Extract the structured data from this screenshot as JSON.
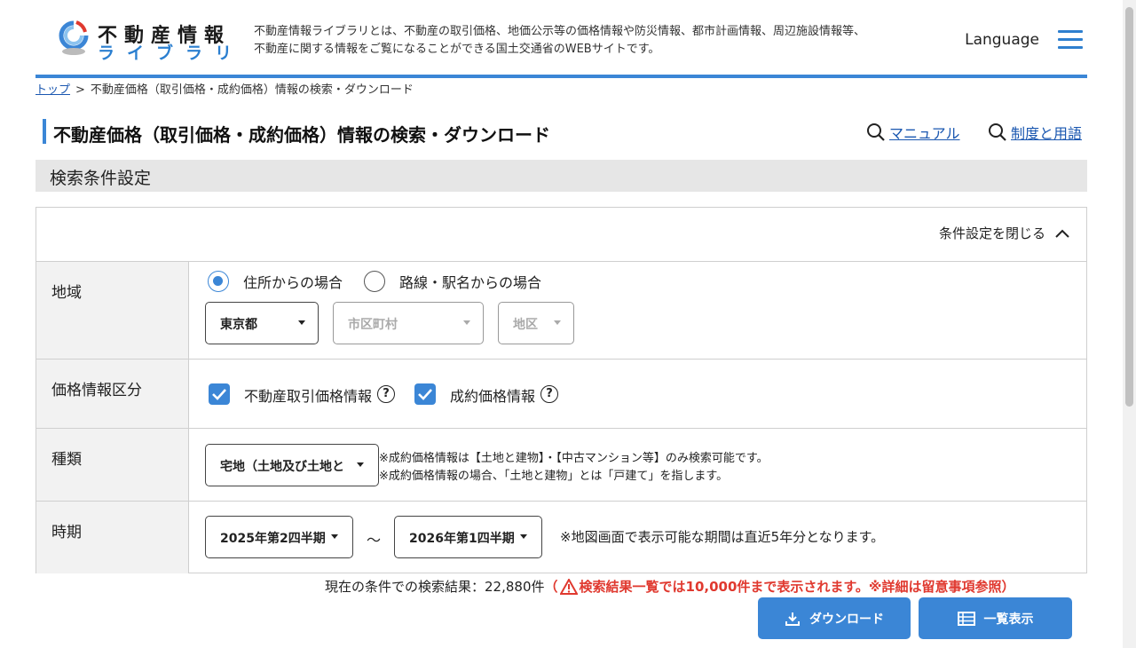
{
  "header": {
    "logo_title": "不動産情報",
    "logo_sub": "ライブラリ",
    "description": "不動産情報ライブラリとは、不動産の取引価格、地価公示等の価格情報や防災情報、都市計画情報、周辺施設情報等、不動産に関する情報をご覧になることができる国土交通省のWEBサイトです。",
    "language_label": "Language",
    "menu_icon": "hamburger-menu-icon",
    "accent_color": "#3b86d6"
  },
  "breadcrumb": {
    "home": "トップ",
    "separator": ">",
    "current": "不動産価格（取引価格・成約価格）情報の検索・ダウンロード"
  },
  "title": {
    "text": "不動産価格（取引価格・成約価格）情報の検索・ダウンロード",
    "manual_link": "マニュアル",
    "terms_link": "制度と用語"
  },
  "section": {
    "heading": "検索条件設定",
    "close_label": "条件設定を閉じる"
  },
  "region": {
    "label": "地域",
    "radio_address": "住所からの場合",
    "radio_station": "路線・駅名からの場合",
    "selected_radio": "住所からの場合",
    "prefecture": "東京都",
    "city_placeholder": "市区町村",
    "district_placeholder": "地区"
  },
  "price_type": {
    "label": "価格情報区分",
    "option_transaction": "不動産取引価格情報",
    "option_contract": "成約価格情報",
    "transaction_checked": true,
    "contract_checked": true
  },
  "kind": {
    "label": "種類",
    "selected": "宅地（土地及び土地と",
    "note_1": "※成約価格情報は【土地と建物】・【中古マンション等】のみ検索可能です。",
    "note_2": "※成約価格情報の場合、「土地と建物」とは「戸建て」を指します。"
  },
  "period": {
    "label": "時期",
    "from": "2025年第2四半期",
    "tilde": "～",
    "to": "2026年第1四半期",
    "note": "※地図画面で表示可能な期間は直近5年分となります。"
  },
  "result": {
    "prefix": "現在の条件での検索結果：",
    "count": "22,880件",
    "warning_open": "（",
    "warning": "検索結果一覧では10,000件まで表示されます。※詳細は留意事項参照）",
    "warning_color": "#e0392f"
  },
  "buttons": {
    "download": "ダウンロード",
    "list": "一覧表示"
  }
}
